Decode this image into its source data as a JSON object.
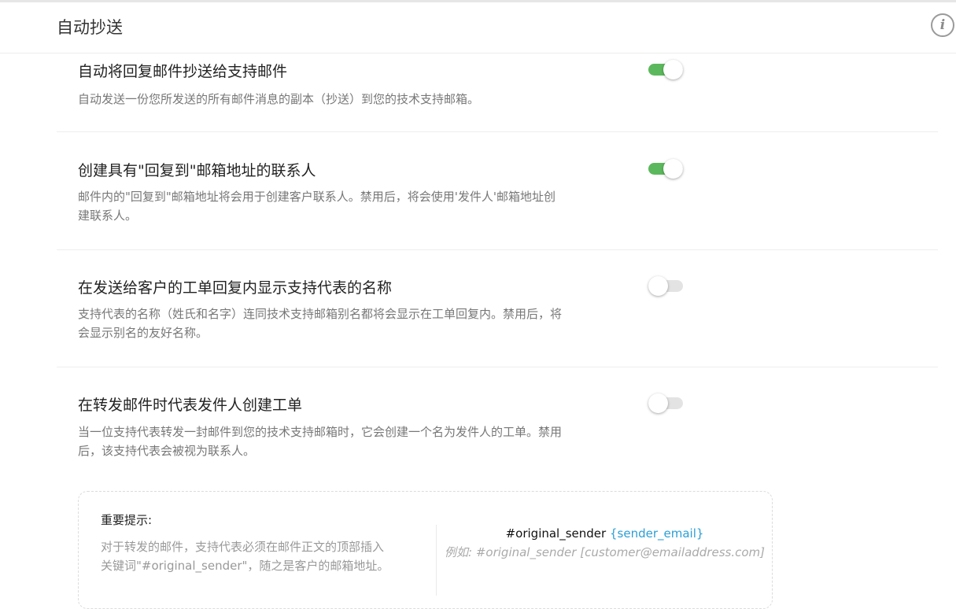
{
  "header": {
    "title": "自动抄送",
    "info_icon": "i"
  },
  "settings": [
    {
      "title": "自动将回复邮件抄送给支持邮件",
      "description": "自动发送一份您所发送的所有邮件消息的副本（抄送）到您的技术支持邮箱。",
      "enabled": true
    },
    {
      "title": "创建具有\"回复到\"邮箱地址的联系人",
      "description": "邮件内的\"回复到\"邮箱地址将会用于创建客户联系人。禁用后，将会使用'发件人'邮箱地址创建联系人。",
      "enabled": true
    },
    {
      "title": "在发送给客户的工单回复内显示支持代表的名称",
      "description": "支持代表的名称（姓氏和名字）连同技术支持邮箱别名都将会显示在工单回复内。禁用后，将会显示别名的友好名称。",
      "enabled": false
    },
    {
      "title": "在转发邮件时代表发件人创建工单",
      "description": "当一位支持代表转发一封邮件到您的技术支持邮箱时，它会创建一个名为发件人的工单。禁用后，该支持代表会被视为联系人。",
      "enabled": false
    }
  ],
  "notice": {
    "title": "重要提示:",
    "body": "对于转发的邮件，支持代表必须在邮件正文的顶部插入关键词\"#original_sender\"，随之是客户的邮箱地址。",
    "keyword": "#original_sender",
    "keyword_var": "{sender_email}",
    "example_label": "例如:",
    "example_value": "#original_sender [customer@emailaddress.com]"
  },
  "colors": {
    "toggle_on": "#5cb85c",
    "toggle_off": "#e3e3e3",
    "keyword_var": "#2a9fd6"
  }
}
